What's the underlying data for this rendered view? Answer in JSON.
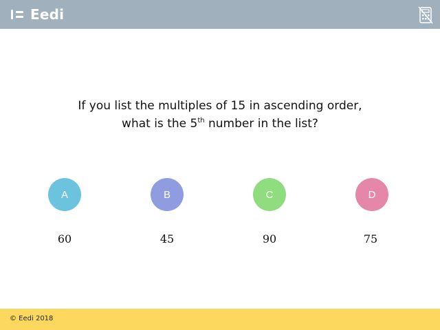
{
  "header": {
    "logo_text": "Eedi",
    "calculator_icon": "no-calculator-icon"
  },
  "question": {
    "text_before": "If you list the multiples of 15 in ascending order, what is the 5",
    "superscript": "th",
    "text_after": " number in the list?"
  },
  "options": [
    {
      "letter": "A",
      "value": "60",
      "color": "#6cc3dd"
    },
    {
      "letter": "B",
      "value": "45",
      "color": "#8f9ce0"
    },
    {
      "letter": "C",
      "value": "90",
      "color": "#8fdd7e"
    },
    {
      "letter": "D",
      "value": "75",
      "color": "#e487a8"
    }
  ],
  "footer": {
    "copyright": "© Eedi 2018"
  },
  "colors": {
    "header_bg": "#a0b0bd",
    "footer_bg": "#fdd85e"
  }
}
